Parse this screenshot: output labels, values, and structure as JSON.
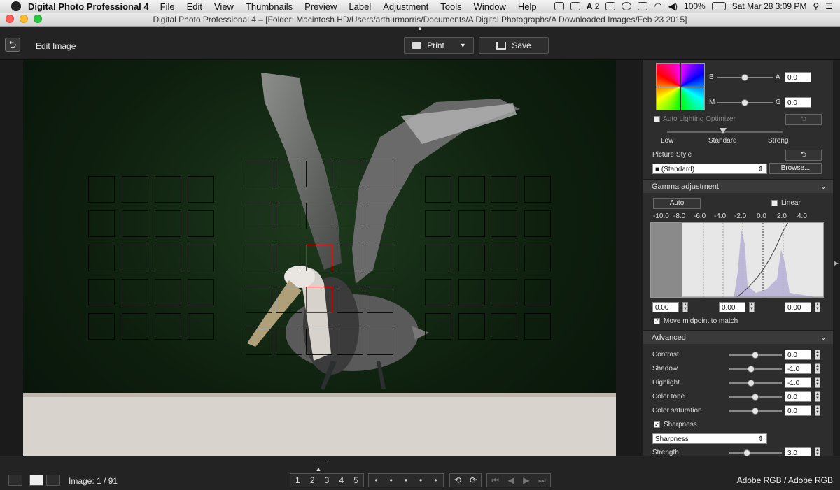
{
  "menubar": {
    "app_name": "Digital Photo Professional 4",
    "items": [
      "File",
      "Edit",
      "View",
      "Thumbnails",
      "Preview",
      "Label",
      "Adjustment",
      "Tools",
      "Window",
      "Help"
    ],
    "status_a": "2",
    "battery": "100%",
    "datetime": "Sat Mar 28  3:09 PM"
  },
  "window": {
    "title": "Digital Photo Professional 4 – [Folder: Macintosh HD/Users/arthurmorris/Documents/A Digital Photographs/A Downloaded Images/Feb 23 2015]"
  },
  "toolbar": {
    "back_icon": "return-arrow",
    "mode_label": "Edit Image",
    "print_label": "Print",
    "save_label": "Save"
  },
  "bottom": {
    "image_count": "Image: 1 / 91",
    "ratings": [
      "1",
      "2",
      "3",
      "4",
      "5"
    ],
    "dots": [
      "•",
      "•",
      "•",
      "•",
      "•"
    ],
    "color_space": "Adobe RGB / Adobe RGB"
  },
  "panel": {
    "color_wheel": {
      "b_label": "B",
      "a_label": "A",
      "a_value": "0.0",
      "m_label": "M",
      "g_label": "G",
      "g_value": "0.0"
    },
    "alo": {
      "label": "Auto Lighting Optimizer",
      "low": "Low",
      "standard": "Standard",
      "strong": "Strong"
    },
    "picture_style": {
      "label": "Picture Style",
      "value": "(Standard)",
      "browse": "Browse..."
    },
    "gamma": {
      "header": "Gamma adjustment",
      "auto": "Auto",
      "linear": "Linear",
      "ticks": [
        "-10.0",
        "-8.0",
        "-6.0",
        "-4.0",
        "-2.0",
        "0.0",
        "2.0",
        "4.0"
      ],
      "field1": "0.00",
      "field2": "0.00",
      "field3": "0.00",
      "move_midpoint": "Move midpoint to match"
    },
    "advanced": {
      "header": "Advanced",
      "contrast_label": "Contrast",
      "contrast_value": "0.0",
      "shadow_label": "Shadow",
      "shadow_value": "-1.0",
      "highlight_label": "Highlight",
      "highlight_value": "-1.0",
      "colortone_label": "Color tone",
      "colortone_value": "0.0",
      "saturation_label": "Color saturation",
      "saturation_value": "0.0",
      "sharpness_check": "Sharpness",
      "sharpness_select": "Sharpness",
      "strength_label": "Strength",
      "strength_value": "3.0"
    }
  }
}
